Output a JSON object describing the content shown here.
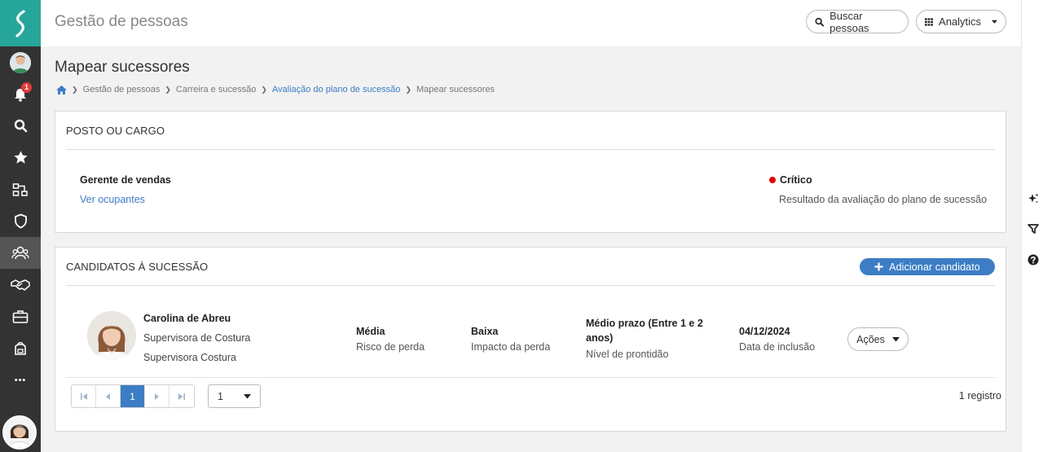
{
  "header": {
    "app_title": "Gestão de pessoas",
    "search_label": "Buscar pessoas",
    "analytics_label": "Analytics"
  },
  "nav": {
    "notifications_count": "1",
    "more_label": "•••",
    "items": [
      {
        "icon": "avatar-icon"
      },
      {
        "icon": "bell-icon"
      },
      {
        "icon": "search-icon"
      },
      {
        "icon": "star-icon"
      },
      {
        "icon": "org-chart-icon"
      },
      {
        "icon": "shield-icon"
      },
      {
        "icon": "people-icon"
      },
      {
        "icon": "handshake-icon"
      },
      {
        "icon": "briefcase-icon"
      },
      {
        "icon": "backpack-icon"
      }
    ]
  },
  "page": {
    "title": "Mapear sucessores",
    "breadcrumb": [
      {
        "label": "Gestão de pessoas",
        "link": false
      },
      {
        "label": "Carreira e sucessão",
        "link": false
      },
      {
        "label": "Avaliação do plano de sucessão",
        "link": true
      },
      {
        "label": "Mapear sucessores",
        "link": false
      }
    ]
  },
  "position_card": {
    "header": "POSTO OU CARGO",
    "position_name": "Gerente de vendas",
    "occupants_link": "Ver ocupantes",
    "status_label": "Crítico",
    "status_color": "#e00000",
    "status_description": "Resultado da avaliação do plano de sucessão"
  },
  "candidates_card": {
    "header": "CANDIDATOS À SUCESSÃO",
    "add_button": "Adicionar candidato",
    "candidates": [
      {
        "name": "Carolina de Abreu",
        "role": "Supervisora de Costura",
        "department": "Supervisora Costura",
        "risk_value": "Média",
        "risk_label": "Risco de perda",
        "impact_value": "Baixa",
        "impact_label": "Impacto da perda",
        "readiness_value_1": "Médio prazo (Entre 1 e 2",
        "readiness_value_2": "anos)",
        "readiness_label": "Nível de prontidão",
        "date_value": "04/12/2024",
        "date_label": "Data de inclusão",
        "actions_label": "Ações"
      }
    ],
    "pagination": {
      "current_page": "1",
      "page_size": "1",
      "records_label": "1 registro"
    }
  },
  "colors": {
    "accent": "#3c7dc4",
    "brand": "#26a69a",
    "nav_bg": "#333333"
  }
}
